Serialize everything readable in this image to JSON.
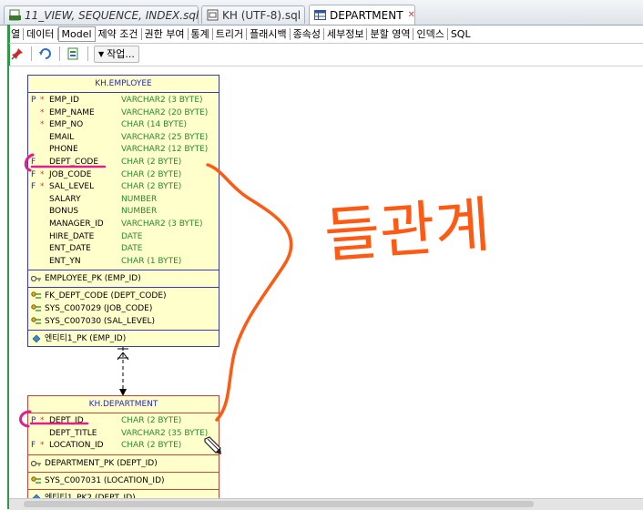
{
  "file_tabs": [
    {
      "label": "11_VIEW, SEQUENCE, INDEX.sql",
      "icon": "sql-file-icon",
      "active": false
    },
    {
      "label": "KH (UTF-8).sql",
      "icon": "sql-worksheet-icon",
      "active": false
    },
    {
      "label": "DEPARTMENT",
      "icon": "table-icon",
      "active": true
    }
  ],
  "sub_tabs": [
    "열",
    "데이터",
    "Model",
    "제약 조건",
    "권한 부여",
    "통계",
    "트리거",
    "플래시백",
    "종속성",
    "세부정보",
    "분할 영역",
    "인덱스",
    "SQL"
  ],
  "active_sub_tab": "Model",
  "toolbar": {
    "action_menu_label": "작업...",
    "icons": [
      "pin-icon",
      "refresh-icon",
      "export-icon"
    ]
  },
  "entities": {
    "employee": {
      "title": "KH.EMPLOYEE",
      "columns": [
        {
          "key": "P",
          "req": "*",
          "name": "EMP_ID",
          "type": "VARCHAR2 (3 BYTE)"
        },
        {
          "key": "",
          "req": "*",
          "name": "EMP_NAME",
          "type": "VARCHAR2 (20 BYTE)"
        },
        {
          "key": "",
          "req": "*",
          "name": "EMP_NO",
          "type": "CHAR (14 BYTE)"
        },
        {
          "key": "",
          "req": "",
          "name": "EMAIL",
          "type": "VARCHAR2 (25 BYTE)"
        },
        {
          "key": "",
          "req": "",
          "name": "PHONE",
          "type": "VARCHAR2 (12 BYTE)"
        },
        {
          "key": "F",
          "req": "",
          "name": "DEPT_CODE",
          "type": "CHAR (2 BYTE)"
        },
        {
          "key": "F",
          "req": "*",
          "name": "JOB_CODE",
          "type": "CHAR (2 BYTE)"
        },
        {
          "key": "F",
          "req": "*",
          "name": "SAL_LEVEL",
          "type": "CHAR (2 BYTE)"
        },
        {
          "key": "",
          "req": "",
          "name": "SALARY",
          "type": "NUMBER"
        },
        {
          "key": "",
          "req": "",
          "name": "BONUS",
          "type": "NUMBER"
        },
        {
          "key": "",
          "req": "",
          "name": "MANAGER_ID",
          "type": "VARCHAR2 (3 BYTE)"
        },
        {
          "key": "",
          "req": "",
          "name": "HIRE_DATE",
          "type": "DATE"
        },
        {
          "key": "",
          "req": "",
          "name": "ENT_DATE",
          "type": "DATE"
        },
        {
          "key": "",
          "req": "",
          "name": "ENT_YN",
          "type": "CHAR (1 BYTE)"
        }
      ],
      "pk": "EMPLOYEE_PK (EMP_ID)",
      "fks": [
        "FK_DEPT_CODE (DEPT_CODE)",
        "SYS_C007029 (JOB_CODE)",
        "SYS_C007030 (SAL_LEVEL)"
      ],
      "indexes": [
        "엔티티1_PK (EMP_ID)"
      ]
    },
    "department": {
      "title": "KH.DEPARTMENT",
      "columns": [
        {
          "key": "P",
          "req": "*",
          "name": "DEPT_ID",
          "type": "CHAR (2 BYTE)"
        },
        {
          "key": "",
          "req": "",
          "name": "DEPT_TITLE",
          "type": "VARCHAR2 (35 BYTE)"
        },
        {
          "key": "F",
          "req": "*",
          "name": "LOCATION_ID",
          "type": "CHAR (2 BYTE)"
        }
      ],
      "pk": "DEPARTMENT_PK (DEPT_ID)",
      "fks": [
        "SYS_C007031 (LOCATION_ID)"
      ],
      "indexes": [
        "엔티티1_PK2 (DEPT_ID)"
      ]
    }
  },
  "annotation": {
    "handwritten_text": "들관계",
    "color": "#ff5a14",
    "highlight_color": "#e0208a"
  },
  "colors": {
    "entity_fill": "#ffffcc",
    "employee_border": "#3a3ab0",
    "department_border": "#c6473a",
    "type_text": "#2b8a2b",
    "title_text": "#2a2aa8"
  }
}
